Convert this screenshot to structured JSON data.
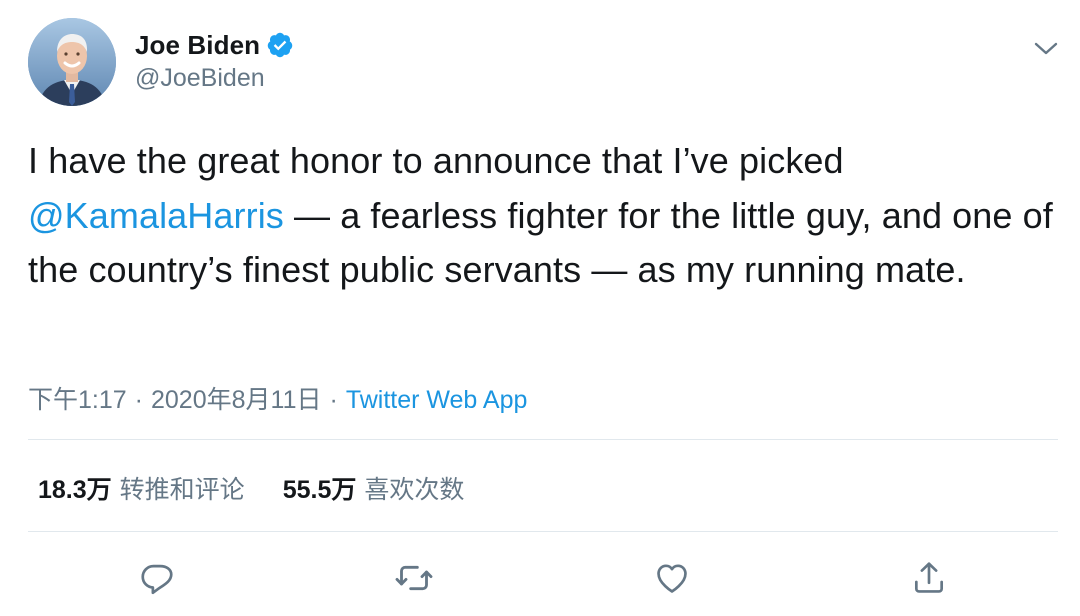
{
  "author": {
    "display_name": "Joe Biden",
    "handle": "@JoeBiden",
    "verified": true,
    "verified_color": "#1da1f2"
  },
  "tweet": {
    "text_before_mention": "I have the great honor to announce that I’ve picked ",
    "mention": "@KamalaHarris",
    "text_after_mention": " — a fearless fighter for the little guy, and one of the country’s finest public servants — as my running mate.",
    "time": "下午1:17",
    "separator": "·",
    "date": "2020年8月11日",
    "source": "Twitter Web App"
  },
  "stats": {
    "retweets_count": "18.3万",
    "retweets_label": "转推和评论",
    "likes_count": "55.5万",
    "likes_label": "喜欢次数"
  },
  "actions": [
    {
      "icon": "reply-icon"
    },
    {
      "icon": "retweet-icon"
    },
    {
      "icon": "like-icon"
    },
    {
      "icon": "share-icon"
    }
  ],
  "colors": {
    "link": "#1b95e0",
    "secondary_text": "#657786",
    "primary_text": "#14171a",
    "divider": "#e1e8ed",
    "icon": "#657786"
  }
}
